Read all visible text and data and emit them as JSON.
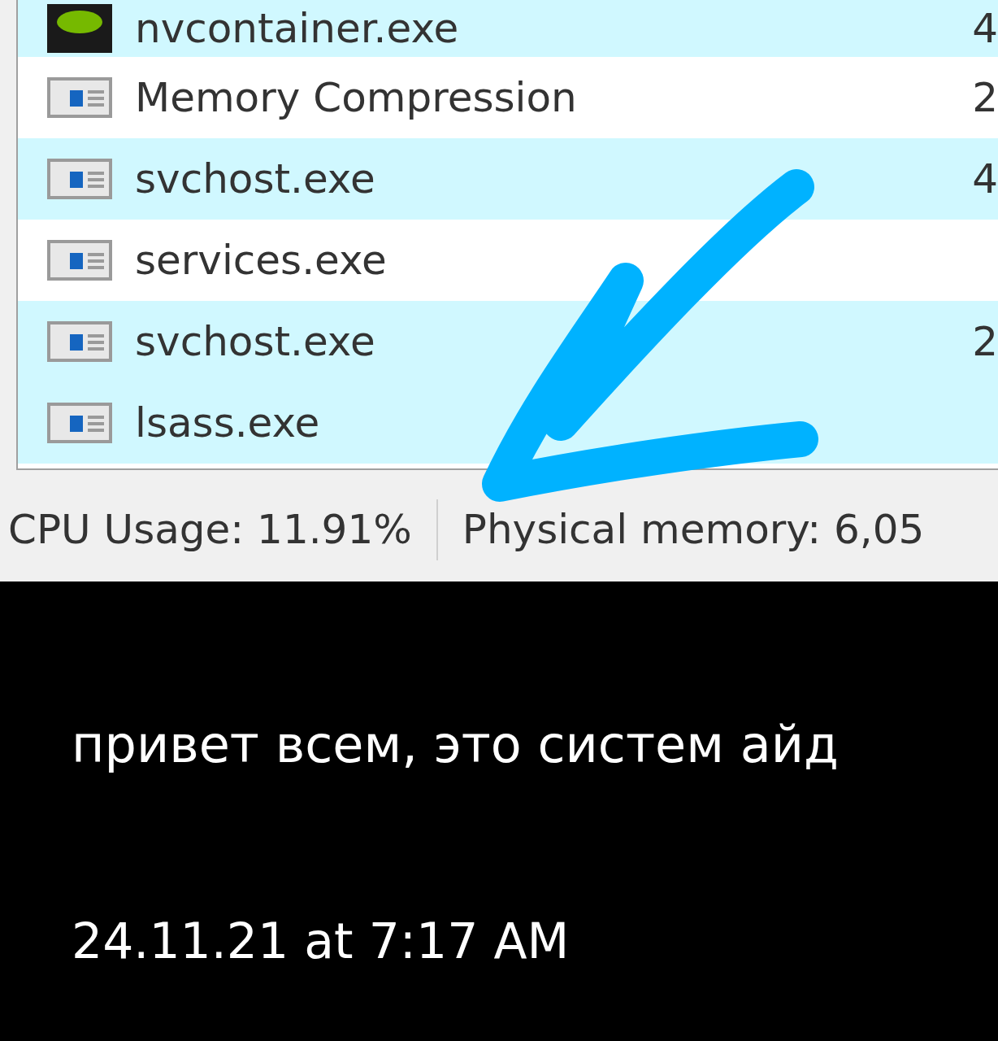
{
  "process_list": {
    "rows": [
      {
        "name": "nvcontainer.exe",
        "kind": "nvidia",
        "color": "#d0f8ff",
        "column_2": "4"
      },
      {
        "name": "Memory Compression",
        "kind": "window",
        "color": "#ffffff",
        "column_2": "2"
      },
      {
        "name": "svchost.exe",
        "kind": "window",
        "color": "#d0f8ff",
        "column_2": "4"
      },
      {
        "name": "services.exe",
        "kind": "window",
        "color": "#ffffff"
      },
      {
        "name": "svchost.exe",
        "kind": "window",
        "color": "#d0f8ff",
        "column_2": "2"
      },
      {
        "name": "lsass.exe",
        "kind": "window",
        "color": "#d0f8ff"
      }
    ]
  },
  "status_bar": [
    "CPU Usage: 11.91%",
    "Physical memory: 6,05"
  ],
  "caption": {
    "message": "привет всем, это систем айд",
    "time": "24.11.21 at 7:17 AM"
  }
}
